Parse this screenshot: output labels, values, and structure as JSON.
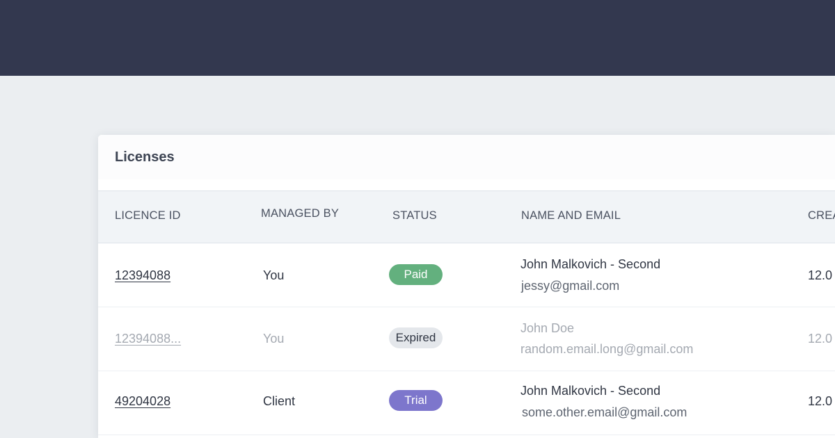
{
  "card": {
    "title": "Licenses"
  },
  "table": {
    "columns": [
      "LICENCE ID",
      "MANAGED BY",
      "STATUS",
      "NAME AND EMAIL",
      "CREA"
    ],
    "rows": [
      {
        "licence_id": "12394088",
        "managed_by": "You",
        "status": "Paid",
        "name": "John Malkovich - Second",
        "email": "jessy@gmail.com",
        "created": "12.0"
      },
      {
        "licence_id": "12394088...",
        "managed_by": "You",
        "status": "Expired",
        "name": "John Doe",
        "email": "random.email.long@gmail.com",
        "created": "12.0"
      },
      {
        "licence_id": "49204028",
        "managed_by": "Client",
        "status": "Trial",
        "name": "John Malkovich - Second",
        "email": "some.other.email@gmail.com",
        "created": "12.0"
      }
    ]
  },
  "colors": {
    "topbar": "#33384f",
    "page_background": "#ebeef1",
    "paid": "#63b07e",
    "expired": "#e4e7eb",
    "trial": "#7d76cc"
  }
}
